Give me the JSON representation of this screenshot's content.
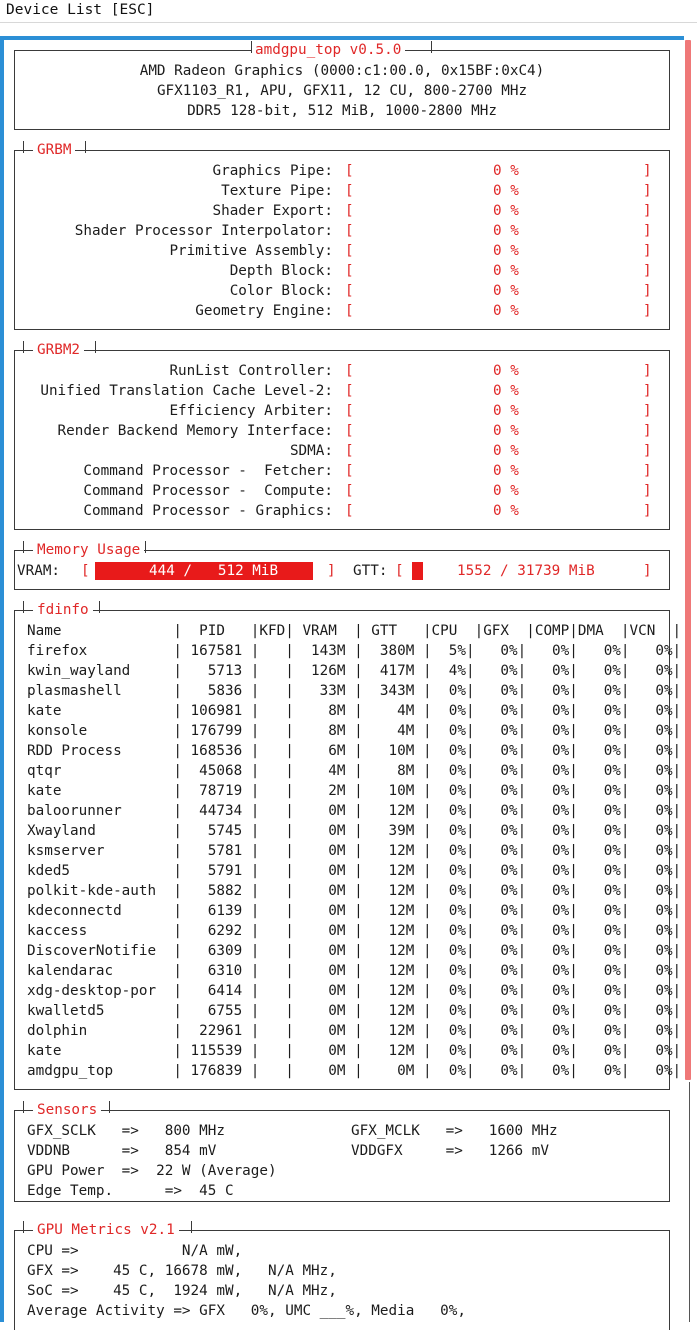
{
  "topbar": {
    "title": "Device List [ESC]"
  },
  "header": {
    "title": "amdgpu_top v0.5.0",
    "line1": "AMD Radeon Graphics (0000:c1:00.0, 0x15BF:0xC4)",
    "line2": "GFX1103_R1, APU, GFX11, 12 CU, 800-2700 MHz",
    "line3": "DDR5 128-bit, 512 MiB, 1000-2800 MHz"
  },
  "grbm": {
    "title": "GRBM",
    "rows": [
      {
        "label": "Graphics Pipe:",
        "value": "0 %"
      },
      {
        "label": "Texture Pipe:",
        "value": "0 %"
      },
      {
        "label": "Shader Export:",
        "value": "0 %"
      },
      {
        "label": "Shader Processor Interpolator:",
        "value": "0 %"
      },
      {
        "label": "Primitive Assembly:",
        "value": "0 %"
      },
      {
        "label": "Depth Block:",
        "value": "0 %"
      },
      {
        "label": "Color Block:",
        "value": "0 %"
      },
      {
        "label": "Geometry Engine:",
        "value": "0 %"
      }
    ]
  },
  "grbm2": {
    "title": "GRBM2",
    "rows": [
      {
        "label": "RunList Controller:",
        "value": "0 %"
      },
      {
        "label": "Unified Translation Cache Level-2:",
        "value": "0 %"
      },
      {
        "label": "Efficiency Arbiter:",
        "value": "0 %"
      },
      {
        "label": "Render Backend Memory Interface:",
        "value": "0 %"
      },
      {
        "label": "SDMA:",
        "value": "0 %"
      },
      {
        "label": "Command Processor -  Fetcher:",
        "value": "0 %"
      },
      {
        "label": "Command Processor -  Compute:",
        "value": "0 %"
      },
      {
        "label": "Command Processor - Graphics:",
        "value": "0 %"
      }
    ]
  },
  "memory": {
    "title": "Memory Usage",
    "vram_label": "VRAM:",
    "vram_value": "444 /   512 MiB",
    "vram_fraction": 0.867,
    "gtt_label": "GTT:",
    "gtt_value": "1552 / 31739 MiB",
    "gtt_fraction": 0.049
  },
  "fdinfo": {
    "title": "fdinfo",
    "header": "Name             |  PID   |KFD| VRAM  | GTT   |CPU  |GFX  |COMP|DMA  |VCN  |",
    "rows": [
      "firefox          | 167581 |   |  143M |  380M |  5%|   0%|   0%|   0%|   0%|",
      "kwin_wayland     |   5713 |   |  126M |  417M |  4%|   0%|   0%|   0%|   0%|",
      "plasmashell      |   5836 |   |   33M |  343M |  0%|   0%|   0%|   0%|   0%|",
      "kate             | 106981 |   |    8M |    4M |  0%|   0%|   0%|   0%|   0%|",
      "konsole          | 176799 |   |    8M |    4M |  0%|   0%|   0%|   0%|   0%|",
      "RDD Process      | 168536 |   |    6M |   10M |  0%|   0%|   0%|   0%|   0%|",
      "qtqr             |  45068 |   |    4M |    8M |  0%|   0%|   0%|   0%|   0%|",
      "kate             |  78719 |   |    2M |   10M |  0%|   0%|   0%|   0%|   0%|",
      "baloorunner      |  44734 |   |    0M |   12M |  0%|   0%|   0%|   0%|   0%|",
      "Xwayland         |   5745 |   |    0M |   39M |  0%|   0%|   0%|   0%|   0%|",
      "ksmserver        |   5781 |   |    0M |   12M |  0%|   0%|   0%|   0%|   0%|",
      "kded5            |   5791 |   |    0M |   12M |  0%|   0%|   0%|   0%|   0%|",
      "polkit-kde-auth  |   5882 |   |    0M |   12M |  0%|   0%|   0%|   0%|   0%|",
      "kdeconnectd      |   6139 |   |    0M |   12M |  0%|   0%|   0%|   0%|   0%|",
      "kaccess          |   6292 |   |    0M |   12M |  0%|   0%|   0%|   0%|   0%|",
      "DiscoverNotifie  |   6309 |   |    0M |   12M |  0%|   0%|   0%|   0%|   0%|",
      "kalendarac       |   6310 |   |    0M |   12M |  0%|   0%|   0%|   0%|   0%|",
      "xdg-desktop-por  |   6414 |   |    0M |   12M |  0%|   0%|   0%|   0%|   0%|",
      "kwalletd5        |   6755 |   |    0M |   12M |  0%|   0%|   0%|   0%|   0%|",
      "dolphin          |  22961 |   |    0M |   12M |  0%|   0%|   0%|   0%|   0%|",
      "kate             | 115539 |   |    0M |   12M |  0%|   0%|   0%|   0%|   0%|",
      "amdgpu_top       | 176839 |   |    0M |    0M |  0%|   0%|   0%|   0%|   0%|"
    ]
  },
  "sensors": {
    "title": "Sensors",
    "rows": [
      {
        "left": "GFX_SCLK   =>   800 MHz",
        "right": "GFX_MCLK   =>   1600 MHz"
      },
      {
        "left": "VDDNB      =>   854 mV",
        "right": "VDDGFX     =>   1266 mV"
      },
      {
        "left": "GPU Power  =>  22 W (Average)",
        "right": ""
      },
      {
        "left": "Edge Temp.      =>  45 C",
        "right": ""
      }
    ]
  },
  "metrics": {
    "title": "GPU Metrics v2.1",
    "rows": [
      "CPU =>            N/A mW,",
      "GFX =>    45 C, 16678 mW,   N/A MHz,",
      "SoC =>    45 C,  1924 mW,   N/A MHz,",
      "Average Activity => GFX   0%, UMC ___%, Media   0%,"
    ]
  },
  "colors": {
    "accent": "#2b8fd6",
    "alert": "#e02828",
    "bar": "#e81a1a"
  }
}
